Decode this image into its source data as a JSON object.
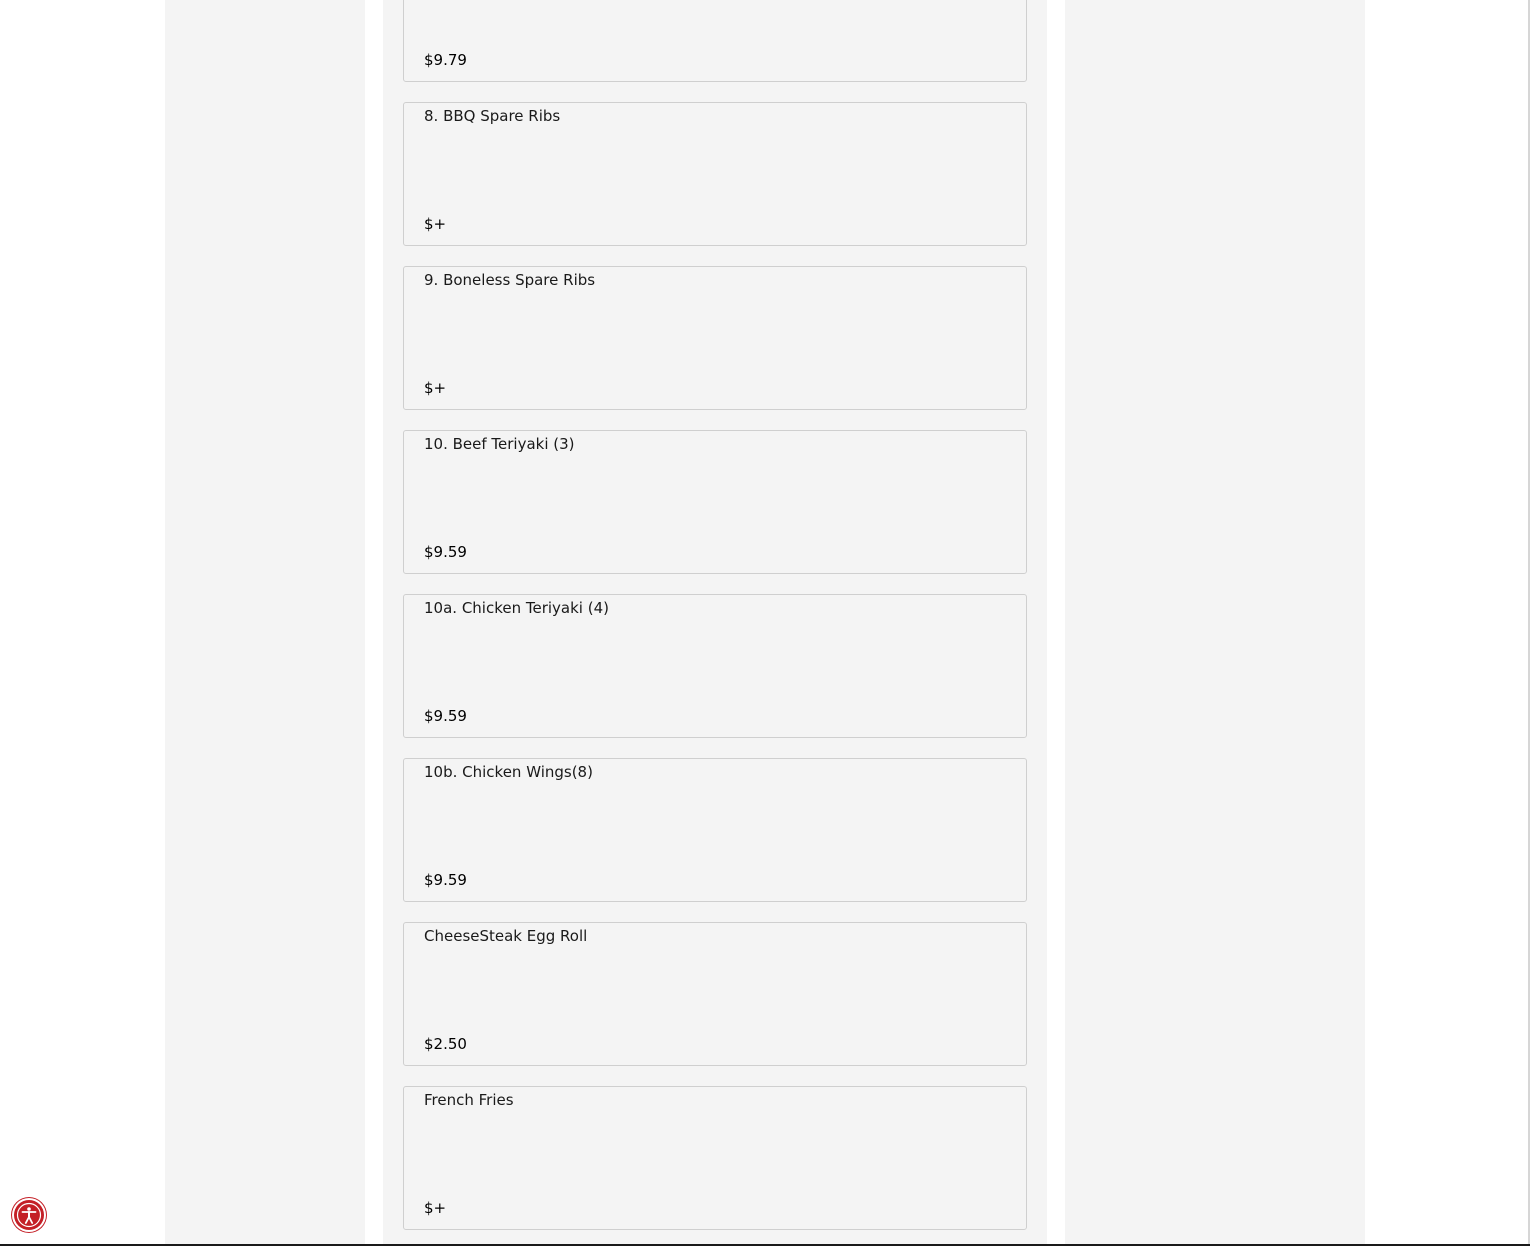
{
  "menu_items": [
    {
      "name": "",
      "price": "$9.79"
    },
    {
      "name": "8. BBQ Spare Ribs",
      "price": "$+"
    },
    {
      "name": "9. Boneless Spare Ribs",
      "price": "$+"
    },
    {
      "name": "10. Beef Teriyaki (3)",
      "price": "$9.59"
    },
    {
      "name": "10a. Chicken Teriyaki (4)",
      "price": "$9.59"
    },
    {
      "name": "10b. Chicken Wings(8)",
      "price": "$9.59"
    },
    {
      "name": "CheeseSteak Egg Roll",
      "price": "$2.50"
    },
    {
      "name": "French Fries",
      "price": "$+"
    }
  ],
  "accessibility_button": {
    "icon": "accessibility-icon",
    "color": "#c41f26"
  }
}
